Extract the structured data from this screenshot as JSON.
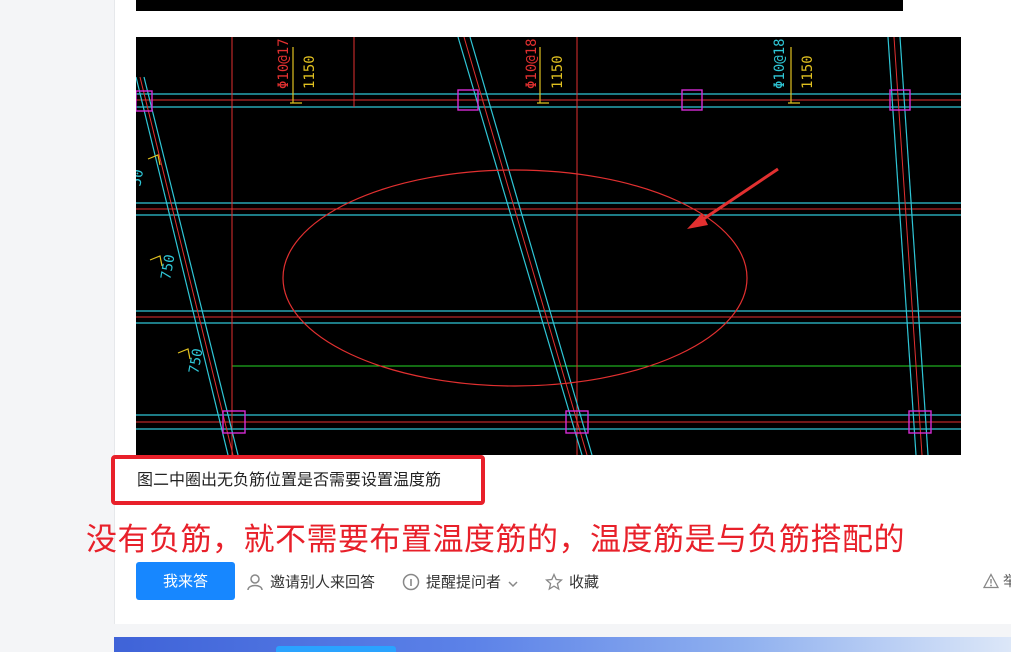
{
  "post": {
    "caption": "图二中圈出无负筋位置是否需要设置温度筋",
    "answer_text": "没有负筋，就不需要布置温度筋的，温度筋是与负筋搭配的"
  },
  "drawing": {
    "dim_labels": [
      "750",
      "750",
      "750",
      "1150",
      "1150",
      "1150",
      "50"
    ],
    "rebar_labels": [
      "Φ10@17",
      "Φ10@18",
      "Φ10@18"
    ]
  },
  "actions": {
    "answer_button": "我来答",
    "invite": "邀请别人来回答",
    "remind": "提醒提问者",
    "favorite": "收藏",
    "report": "举"
  },
  "colors": {
    "accent": "#1787ff",
    "annotation_red": "#e8202a"
  }
}
